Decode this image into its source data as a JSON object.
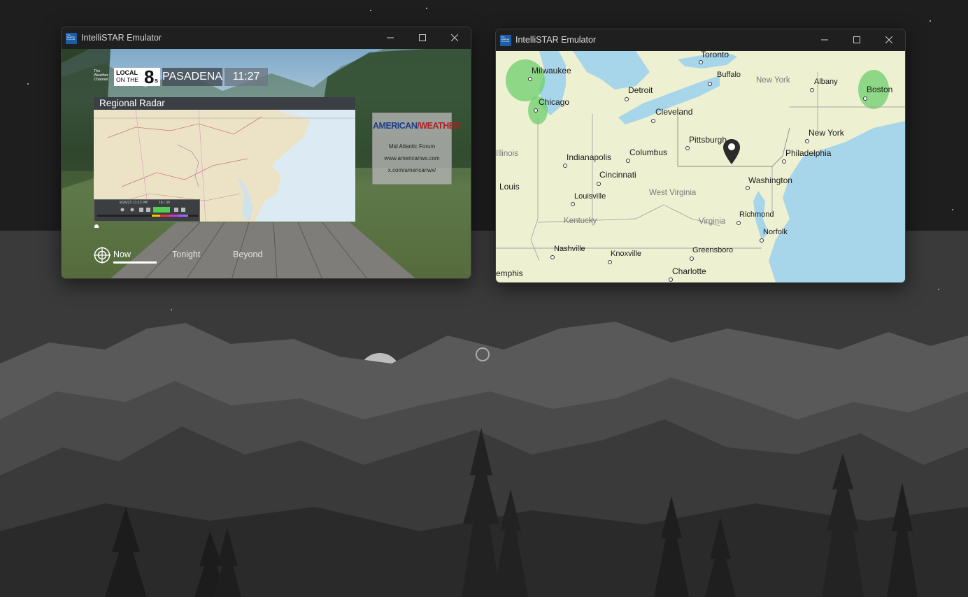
{
  "windows": [
    {
      "title": "IntelliSTAR Emulator",
      "app_icon": "weather-channel-icon",
      "controls": [
        "minimize-icon",
        "maximize-icon",
        "close-icon"
      ],
      "screen": {
        "logo_text": "The Weather Channel",
        "brand_local": "LOCAL",
        "brand_onthe": "ON THE",
        "brand_eight": "8",
        "brand_s": "s",
        "location": "PASADENA",
        "time": "11:27",
        "panel_title": "Regional Radar",
        "radar_timestamp": "8/26/25 11:15 PM",
        "radar_frame": "16 / 30",
        "sponsor": {
          "name_part1": "AMERICAN",
          "name_part2": "WEATHER",
          "line1": "Mid Atlantic Forum",
          "line2": "www.americanwx.com",
          "line3": "x.com/americanwx/",
          "colors": {
            "blue": "#1e3f8a",
            "red": "#b01e23"
          }
        },
        "nav": [
          {
            "label": "Now",
            "active": true,
            "icon": "radar-target-icon"
          },
          {
            "label": "Tonight",
            "active": false
          },
          {
            "label": "Beyond",
            "active": false
          }
        ]
      }
    },
    {
      "title": "IntelliSTAR Emulator",
      "app_icon": "weather-channel-icon",
      "controls": [
        "minimize-icon",
        "maximize-icon",
        "close-icon"
      ],
      "map": {
        "cities": [
          "Toronto",
          "Milwaukee",
          "Buffalo",
          "Albany",
          "Boston",
          "Detroit",
          "Chicago",
          "Cleveland",
          "New York",
          "Pittsburgh",
          "Indianapolis",
          "Columbus",
          "Philadelphia",
          "Cincinnati",
          "Washington",
          "Louis",
          "Louisville",
          "Richmond",
          "Norfolk",
          "Nashville",
          "Knoxville",
          "Greensboro",
          "Charlotte",
          "emphis"
        ],
        "regions": [
          "New York",
          "Illinois",
          "West Virginia",
          "Kentucky",
          "Virginia"
        ],
        "marker_icon": "location-pin-icon",
        "colors": {
          "land": "#eef0d2",
          "water": "#a7d5ea",
          "radar": "#59c259"
        }
      }
    }
  ]
}
